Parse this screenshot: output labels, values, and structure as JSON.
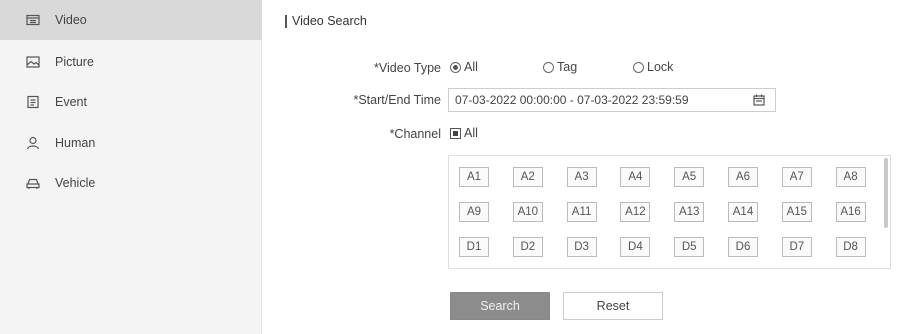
{
  "sidebar": {
    "items": [
      {
        "label": "Video",
        "icon": "video-icon",
        "active": true
      },
      {
        "label": "Picture",
        "icon": "picture-icon",
        "active": false
      },
      {
        "label": "Event",
        "icon": "event-icon",
        "active": false
      },
      {
        "label": "Human",
        "icon": "human-icon",
        "active": false
      },
      {
        "label": "Vehicle",
        "icon": "vehicle-icon",
        "active": false
      }
    ]
  },
  "main": {
    "title": "Video Search",
    "video_type": {
      "label": "*Video Type",
      "options": [
        "All",
        "Tag",
        "Lock"
      ],
      "selected": "All"
    },
    "time_range": {
      "label": "*Start/End Time",
      "value": "07-03-2022 00:00:00 - 07-03-2022 23:59:59"
    },
    "channel": {
      "label": "*Channel",
      "all_label": "All",
      "all_checked": true,
      "channels": [
        "A1",
        "A2",
        "A3",
        "A4",
        "A5",
        "A6",
        "A7",
        "A8",
        "A9",
        "A10",
        "A11",
        "A12",
        "A13",
        "A14",
        "A15",
        "A16",
        "D1",
        "D2",
        "D3",
        "D4",
        "D5",
        "D6",
        "D7",
        "D8"
      ]
    },
    "buttons": {
      "search": "Search",
      "reset": "Reset"
    }
  },
  "colors": {
    "sidebar_bg": "#f4f4f4",
    "sidebar_active": "#d9d9d9",
    "search_button": "#8c8c8c"
  }
}
